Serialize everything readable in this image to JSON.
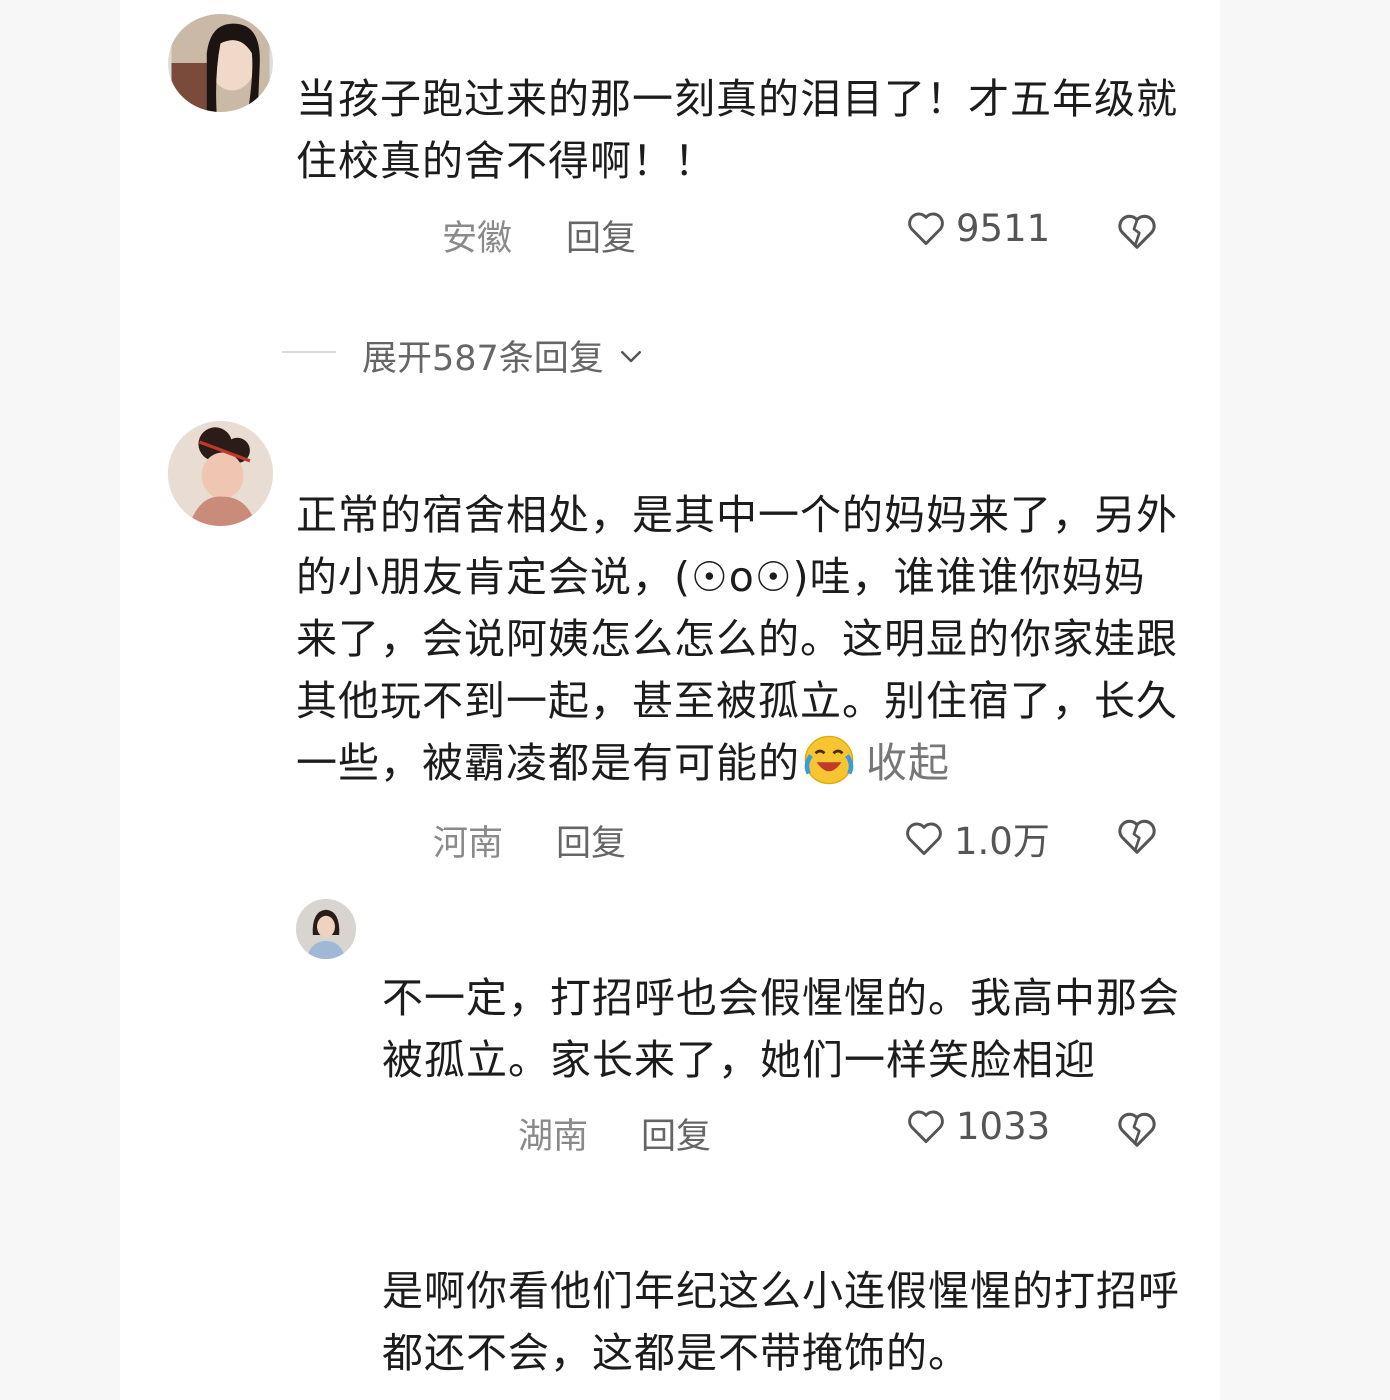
{
  "comments": [
    {
      "text": "当孩子跑过来的那一刻真的泪目了！才五年级就住校真的舍不得啊！！",
      "location": "安徽",
      "reply_label": "回复",
      "likes": "9511",
      "expand_label": "展开587条回复"
    },
    {
      "text": "正常的宿舍相处，是其中一个的妈妈来了，另外的小朋友肯定会说，(☉o☉)哇，谁谁谁你妈妈来了，会说阿姨怎么怎么的。这明显的你家娃跟其他玩不到一起，甚至被孤立。别住宿了，长久一些，被霸凌都是有可能的",
      "collapse_label": "收起",
      "location": "河南",
      "reply_label": "回复",
      "likes": "1.0万"
    }
  ],
  "replies": [
    {
      "text": "不一定，打招呼也会假惺惺的。我高中那会被孤立。家长来了，她们一样笑脸相迎",
      "location": "湖南",
      "reply_label": "回复",
      "likes": "1033"
    },
    {
      "text": "是啊你看他们年纪这么小连假惺惺的打招呼都还不会，这都是不带掩饰的。"
    }
  ],
  "icons": {
    "like": "heart-outline-icon",
    "dislike": "broken-heart-icon",
    "expand": "chevron-down-icon",
    "emoji": "crying-laughing-emoji"
  },
  "colors": {
    "text": "#1c1c1c",
    "meta": "#8a8a8a",
    "icon": "#555555"
  }
}
